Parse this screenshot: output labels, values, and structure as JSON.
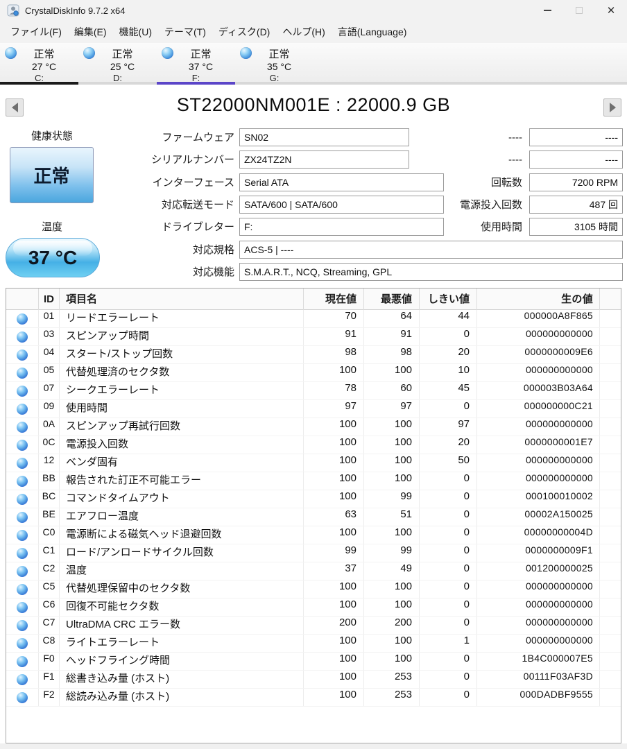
{
  "window": {
    "title": "CrystalDiskInfo 9.7.2 x64"
  },
  "menu": {
    "items": [
      "ファイル(F)",
      "編集(E)",
      "機能(U)",
      "テーマ(T)",
      "ディスク(D)",
      "ヘルプ(H)",
      "言語(Language)"
    ]
  },
  "tabs": [
    {
      "status": "正常",
      "temp": "27 °C",
      "drive": "C:",
      "underline": "#1a1a1a"
    },
    {
      "status": "正常",
      "temp": "25 °C",
      "drive": "D:",
      "underline": "#d8d8d8"
    },
    {
      "status": "正常",
      "temp": "37 °C",
      "drive": "F:",
      "underline": "#5b45c8"
    },
    {
      "status": "正常",
      "temp": "35 °C",
      "drive": "G:",
      "underline": "#d8d8d8"
    }
  ],
  "drive": {
    "title": "ST22000NM001E : 22000.9 GB",
    "health_label": "健康状態",
    "health_value": "正常",
    "temp_label": "温度",
    "temp_value": "37 °C",
    "fields_left": [
      {
        "label": "ファームウェア",
        "value": "SN02"
      },
      {
        "label": "シリアルナンバー",
        "value": "ZX24TZ2N"
      },
      {
        "label": "インターフェース",
        "value": "Serial ATA"
      },
      {
        "label": "対応転送モード",
        "value": "SATA/600 | SATA/600"
      },
      {
        "label": "ドライブレター",
        "value": "F:"
      },
      {
        "label": "対応規格",
        "value": "ACS-5 | ----"
      },
      {
        "label": "対応機能",
        "value": "S.M.A.R.T., NCQ, Streaming, GPL"
      }
    ],
    "fields_right": [
      {
        "label": "----",
        "value": "----"
      },
      {
        "label": "----",
        "value": "----"
      },
      {
        "label": "回転数",
        "value": "7200 RPM"
      },
      {
        "label": "電源投入回数",
        "value": "487 回"
      },
      {
        "label": "使用時間",
        "value": "3105 時間"
      }
    ]
  },
  "smart": {
    "headers": [
      "ID",
      "項目名",
      "現在値",
      "最悪値",
      "しきい値",
      "生の値"
    ],
    "rows": [
      [
        "01",
        "リードエラーレート",
        "70",
        "64",
        "44",
        "000000A8F865"
      ],
      [
        "03",
        "スピンアップ時間",
        "91",
        "91",
        "0",
        "000000000000"
      ],
      [
        "04",
        "スタート/ストップ回数",
        "98",
        "98",
        "20",
        "0000000009E6"
      ],
      [
        "05",
        "代替処理済のセクタ数",
        "100",
        "100",
        "10",
        "000000000000"
      ],
      [
        "07",
        "シークエラーレート",
        "78",
        "60",
        "45",
        "000003B03A64"
      ],
      [
        "09",
        "使用時間",
        "97",
        "97",
        "0",
        "000000000C21"
      ],
      [
        "0A",
        "スピンアップ再試行回数",
        "100",
        "100",
        "97",
        "000000000000"
      ],
      [
        "0C",
        "電源投入回数",
        "100",
        "100",
        "20",
        "0000000001E7"
      ],
      [
        "12",
        "ベンダ固有",
        "100",
        "100",
        "50",
        "000000000000"
      ],
      [
        "BB",
        "報告された訂正不可能エラー",
        "100",
        "100",
        "0",
        "000000000000"
      ],
      [
        "BC",
        "コマンドタイムアウト",
        "100",
        "99",
        "0",
        "000100010002"
      ],
      [
        "BE",
        "エアフロー温度",
        "63",
        "51",
        "0",
        "00002A150025"
      ],
      [
        "C0",
        "電源断による磁気ヘッド退避回数",
        "100",
        "100",
        "0",
        "00000000004D"
      ],
      [
        "C1",
        "ロード/アンロードサイクル回数",
        "99",
        "99",
        "0",
        "0000000009F1"
      ],
      [
        "C2",
        "温度",
        "37",
        "49",
        "0",
        "001200000025"
      ],
      [
        "C5",
        "代替処理保留中のセクタ数",
        "100",
        "100",
        "0",
        "000000000000"
      ],
      [
        "C6",
        "回復不可能セクタ数",
        "100",
        "100",
        "0",
        "000000000000"
      ],
      [
        "C7",
        "UltraDMA CRC エラー数",
        "200",
        "200",
        "0",
        "000000000000"
      ],
      [
        "C8",
        "ライトエラーレート",
        "100",
        "100",
        "1",
        "000000000000"
      ],
      [
        "F0",
        "ヘッドフライング時間",
        "100",
        "100",
        "0",
        "1B4C000007E5"
      ],
      [
        "F1",
        "総書き込み量 (ホスト)",
        "100",
        "253",
        "0",
        "00111F03AF3D"
      ],
      [
        "F2",
        "総読み込み量 (ホスト)",
        "100",
        "253",
        "0",
        "000DADBF9555"
      ]
    ]
  },
  "colors": {
    "selected_tab_underline": "#5b45c8",
    "health_good_blue": "#4aa6de",
    "status_orb_blue": "#3b82d8",
    "titlebar_bg": "#f2f2f2"
  }
}
